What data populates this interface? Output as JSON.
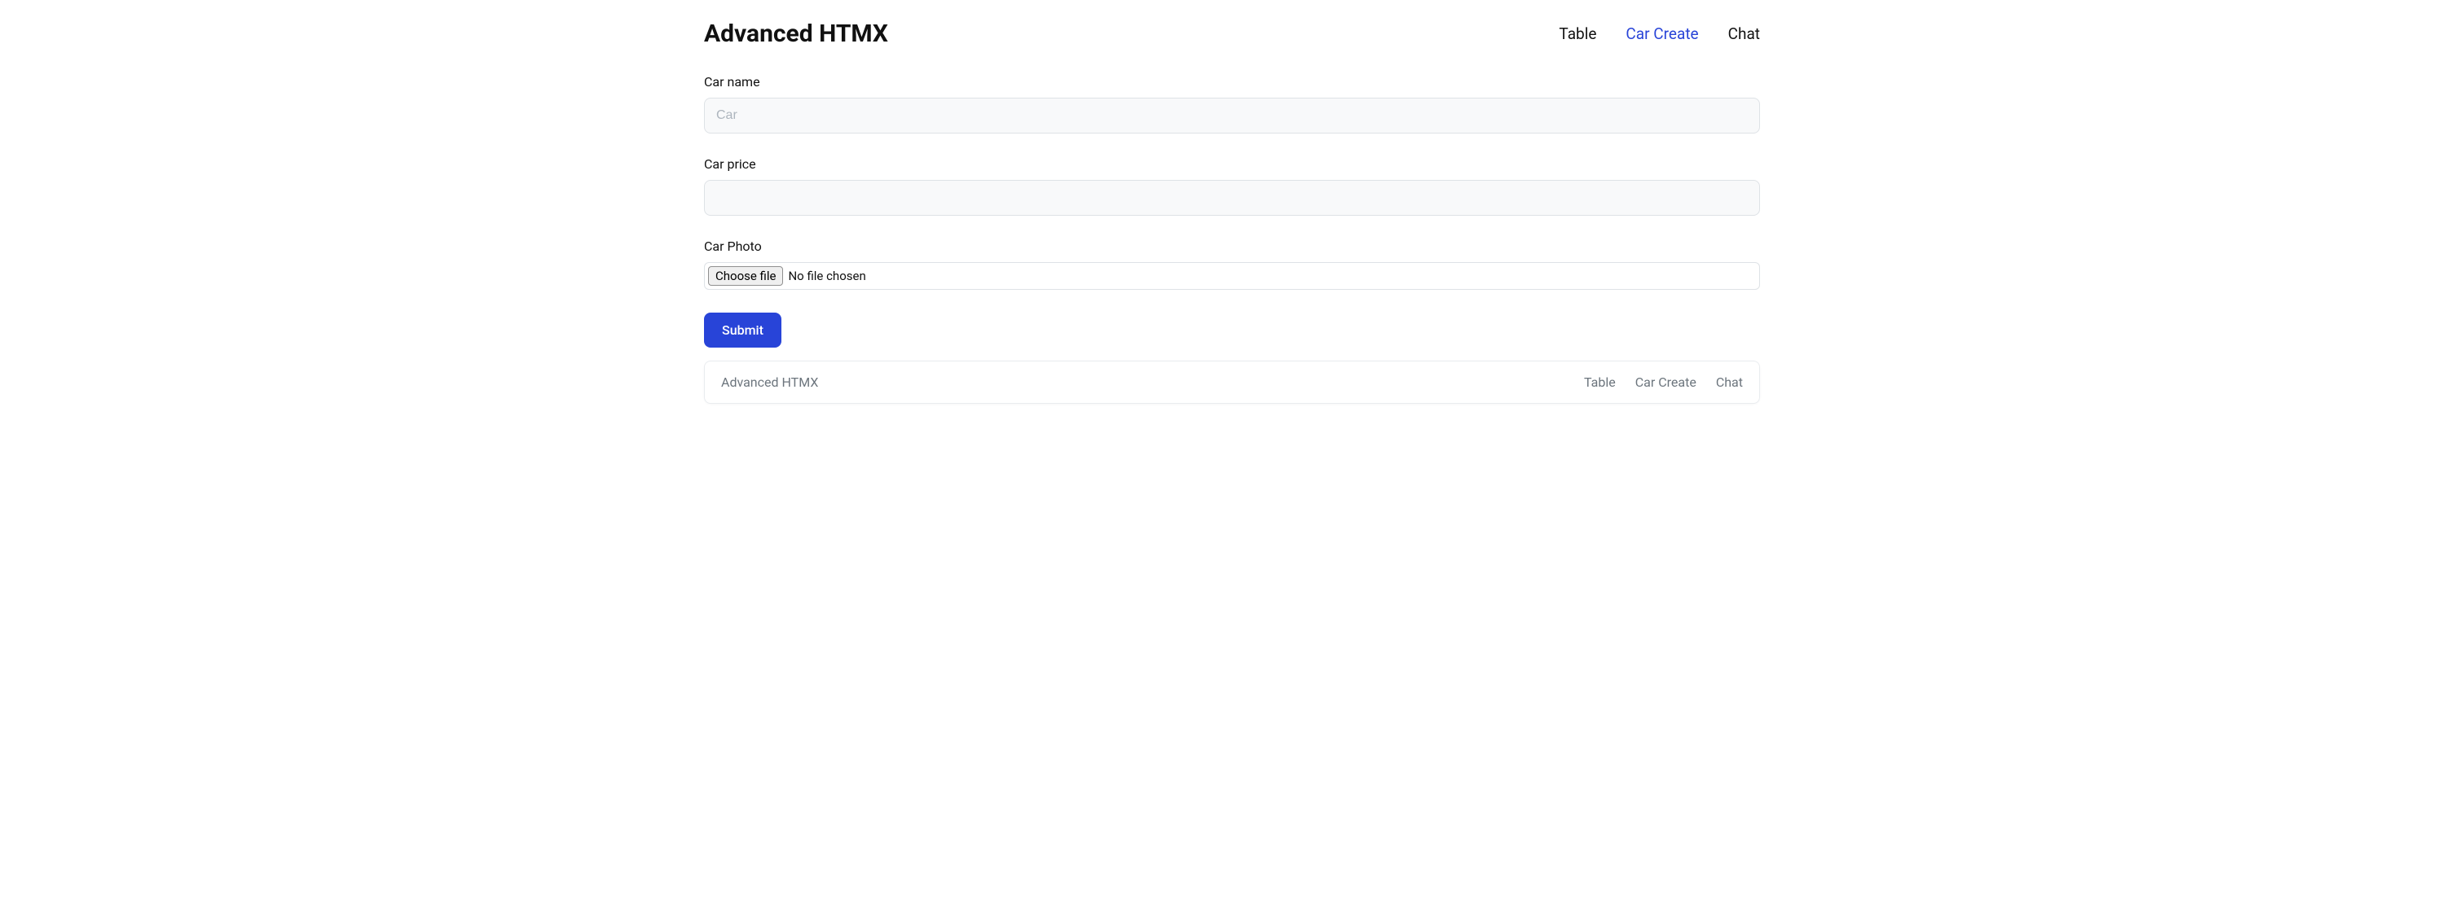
{
  "header": {
    "brand": "Advanced HTMX",
    "nav": [
      {
        "label": "Table",
        "active": false
      },
      {
        "label": "Car Create",
        "active": true
      },
      {
        "label": "Chat",
        "active": false
      }
    ]
  },
  "form": {
    "car_name": {
      "label": "Car name",
      "placeholder": "Car",
      "value": ""
    },
    "car_price": {
      "label": "Car price",
      "placeholder": "",
      "value": ""
    },
    "car_photo": {
      "label": "Car Photo",
      "button_label": "Choose file",
      "status_text": "No file chosen"
    },
    "submit_label": "Submit"
  },
  "footer": {
    "brand": "Advanced HTMX",
    "nav": [
      {
        "label": "Table"
      },
      {
        "label": "Car Create"
      },
      {
        "label": "Chat"
      }
    ]
  }
}
